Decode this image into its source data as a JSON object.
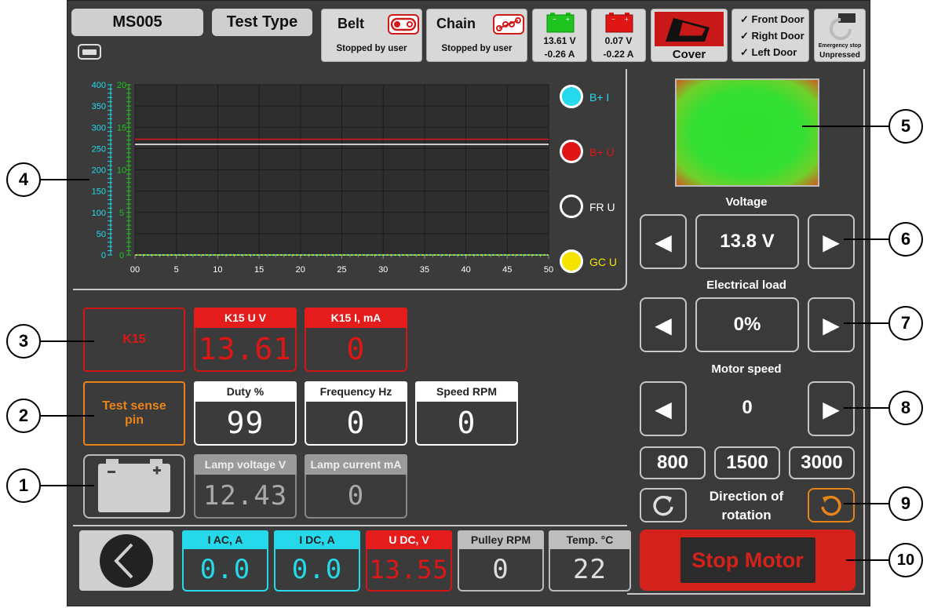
{
  "header": {
    "device_id": "MS005",
    "test_type": "Test Type",
    "belt": {
      "label": "Belt",
      "status": "Stopped by user"
    },
    "chain": {
      "label": "Chain",
      "status": "Stopped by user"
    },
    "battery_green": {
      "voltage": "13.61 V",
      "current": "-0.26 A"
    },
    "battery_red": {
      "voltage": "0.07 V",
      "current": "-0.22 A"
    },
    "cover_label": "Cover",
    "doors": [
      "✓ Front Door",
      "✓ Right Door",
      "✓ Left Door"
    ],
    "emergency": {
      "title": "Emergency stop",
      "status": "Unpressed"
    }
  },
  "chart_data": {
    "type": "line",
    "x_ticks": [
      "00",
      "5",
      "10",
      "15",
      "20",
      "25",
      "30",
      "35",
      "40",
      "45",
      "50"
    ],
    "y_left_ticks": [
      "400",
      "350",
      "300",
      "250",
      "200",
      "150",
      "100",
      "50",
      "0"
    ],
    "y_right_ticks": [
      "20",
      "15",
      "10",
      "5",
      "0"
    ],
    "xlim": [
      0,
      50
    ],
    "ylim_left": [
      0,
      400
    ],
    "ylim_right": [
      0,
      20
    ],
    "grid": true,
    "legend_position": "right",
    "series": [
      {
        "name": "B+ I",
        "color": "#25d9ea",
        "axis": "left",
        "x": [
          0,
          50
        ],
        "y": [
          0,
          0
        ]
      },
      {
        "name": "B+ U",
        "color": "#e01515",
        "axis": "right",
        "x": [
          0,
          50
        ],
        "y": [
          13.6,
          13.6
        ]
      },
      {
        "name": "FR U",
        "color": "#ffffff",
        "axis": "right",
        "x": [
          0,
          50
        ],
        "y": [
          13.0,
          13.0
        ]
      },
      {
        "name": "GC U",
        "color": "#f5e400",
        "axis": "right",
        "x": [
          0,
          50
        ],
        "y": [
          0,
          0
        ]
      }
    ]
  },
  "controls": {
    "voltage_label": "Voltage",
    "voltage_value": "13.8 V",
    "load_label": "Electrical load",
    "load_value": "0%",
    "speed_label": "Motor speed",
    "speed_value": "0",
    "presets": [
      "800",
      "1500",
      "3000"
    ],
    "direction_label_1": "Direction of",
    "direction_label_2": "rotation"
  },
  "measurements": {
    "k15_label": "K15",
    "k15_u": {
      "label": "K15 U V",
      "value": "13.61"
    },
    "k15_i": {
      "label": "K15 I, mA",
      "value": "0"
    },
    "test_sense_1": "Test sense",
    "test_sense_2": "pin",
    "duty": {
      "label": "Duty %",
      "value": "99"
    },
    "frequency": {
      "label": "Frequency Hz",
      "value": "0"
    },
    "speed": {
      "label": "Speed RPM",
      "value": "0"
    },
    "lamp_voltage": {
      "label": "Lamp voltage V",
      "value": "12.43"
    },
    "lamp_current": {
      "label": "Lamp current mA",
      "value": "0"
    }
  },
  "bottom": {
    "i_ac": {
      "label": "I AC, A",
      "value": "0.0"
    },
    "i_dc": {
      "label": "I DC, A",
      "value": "0.0"
    },
    "u_dc": {
      "label": "U DC, V",
      "value": "13.55"
    },
    "pulley": {
      "label": "Pulley RPM",
      "value": "0"
    },
    "temp": {
      "label": "Temp. °C",
      "value": "22"
    },
    "stop_motor": "Stop Motor"
  },
  "callouts": [
    "1",
    "2",
    "3",
    "4",
    "5",
    "6",
    "7",
    "8",
    "9",
    "10"
  ],
  "colors": {
    "background": "#3b3b3b",
    "cyan": "#25d9ea",
    "red": "#e01515",
    "orange": "#e8841a",
    "green": "#1fc41f"
  }
}
